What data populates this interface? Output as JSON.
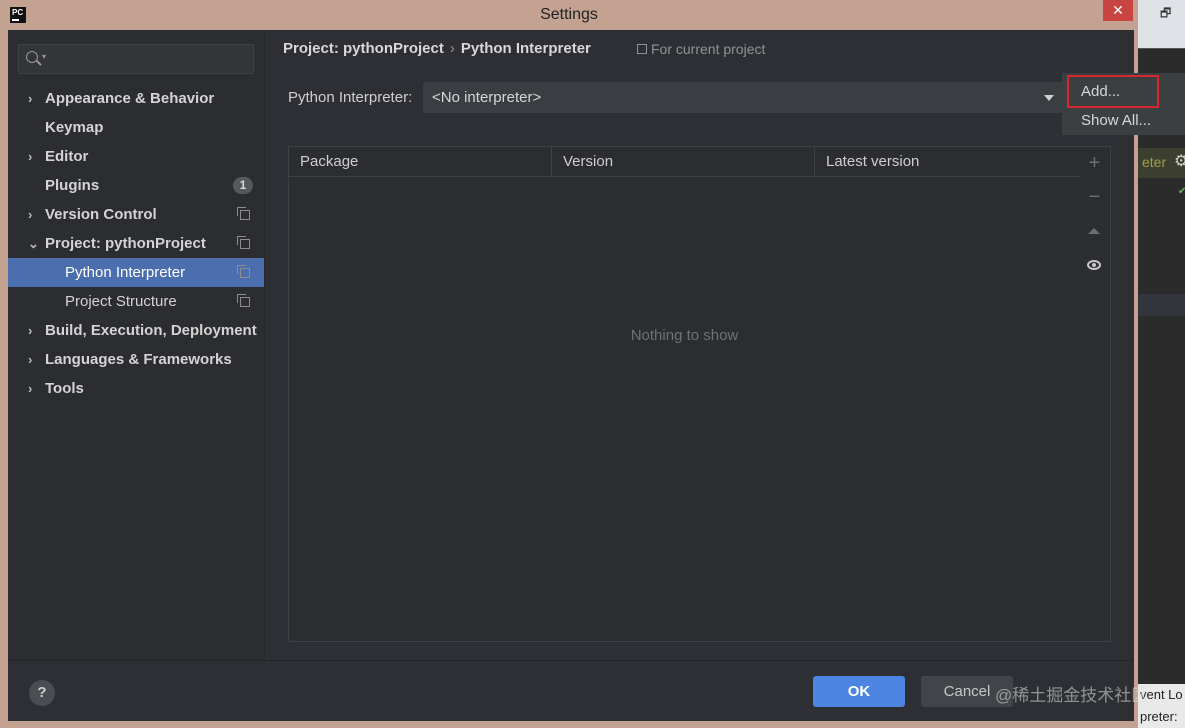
{
  "window": {
    "title": "Settings",
    "app_icon_text": "PC",
    "close_glyph": "✕"
  },
  "search": {
    "icon": "search-icon",
    "caret": "▾"
  },
  "sidebar": {
    "items": [
      {
        "label": "Appearance & Behavior",
        "expander": "›",
        "bold": true
      },
      {
        "label": "Keymap",
        "bold": true
      },
      {
        "label": "Editor",
        "expander": "›",
        "bold": true
      },
      {
        "label": "Plugins",
        "bold": true,
        "badge": "1"
      },
      {
        "label": "Version Control",
        "expander": "›",
        "bold": true,
        "icon": "copy-icon"
      },
      {
        "label": "Project: pythonProject",
        "expander": "⌄",
        "bold": true,
        "icon": "copy-icon"
      },
      {
        "label": "Python Interpreter",
        "selected": true,
        "icon": "copy-icon"
      },
      {
        "label": "Project Structure",
        "icon": "copy-icon"
      },
      {
        "label": "Build, Execution, Deployment",
        "expander": "›",
        "bold": true
      },
      {
        "label": "Languages & Frameworks",
        "expander": "›",
        "bold": true
      },
      {
        "label": "Tools",
        "expander": "›",
        "bold": true
      }
    ]
  },
  "breadcrumb": {
    "project": "Project: pythonProject",
    "separator": "›",
    "page": "Python Interpreter",
    "scope": "For current project"
  },
  "interpreter": {
    "label": "Python Interpreter:",
    "value": "<No interpreter>"
  },
  "popup": {
    "add": "Add...",
    "show_all": "Show All..."
  },
  "table": {
    "columns": [
      "Package",
      "Version",
      "Latest version"
    ],
    "empty_text": "Nothing to show",
    "tools": {
      "add": "+",
      "remove": "−"
    }
  },
  "footer": {
    "help": "?",
    "ok": "OK",
    "cancel": "Cancel"
  },
  "background_app": {
    "restore_glyph": "🗗",
    "chip_text": "eter",
    "check": "✔",
    "status_line_1": "vent Lo",
    "status_line_2": "preter:"
  },
  "watermark": "@稀土掘金技术社区",
  "colors": {
    "accent": "#4b6eaf",
    "ok_button": "#4c86e2",
    "highlight_box": "#d8262e",
    "window_frame": "#c3a291"
  }
}
